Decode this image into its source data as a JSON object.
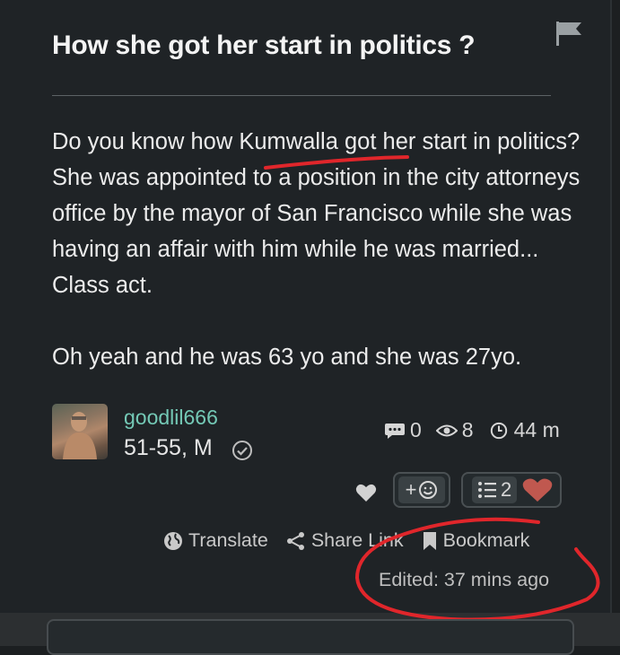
{
  "post": {
    "title": "How she got her start in politics ?",
    "paragraphs": [
      "Do you know how Kumwalla got her start in politics? She was appointed to a position in the city attorneys office by the mayor of San Francisco while she was having an affair with him while he was married... Class act.",
      "Oh yeah and he was 63 yo and she was 27yo."
    ]
  },
  "author": {
    "username": "goodlil666",
    "age_gender": "51-55, M"
  },
  "stats": {
    "comments": "0",
    "views": "8",
    "time": "44 m"
  },
  "reactions": {
    "add_label": "+",
    "list_count": "2"
  },
  "actions": {
    "translate": "Translate",
    "share": "Share Link",
    "bookmark": "Bookmark"
  },
  "edited": "Edited: 37 mins ago",
  "colors": {
    "background": "#1f2326",
    "username": "#74c9b6",
    "annotation": "#e0262b",
    "heart": "#c0584f"
  },
  "icons": [
    "flag-icon",
    "verified-icon",
    "comment-icon",
    "eye-icon",
    "clock-icon",
    "heart-icon",
    "smiley-icon",
    "list-icon",
    "globe-icon",
    "share-icon",
    "bookmark-icon"
  ]
}
